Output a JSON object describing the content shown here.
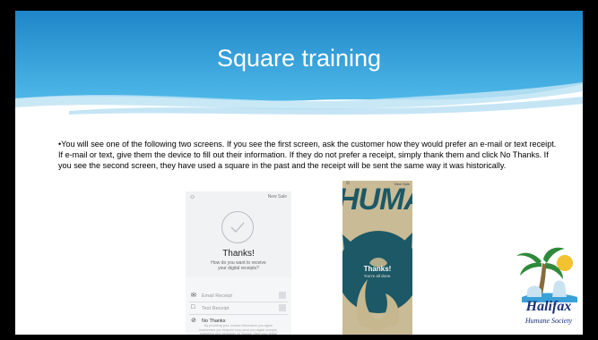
{
  "slide": {
    "title": "Square training",
    "body": "•You will see one of the following two screens. If you see the first screen, ask the customer how they would prefer an e-mail or text receipt. If e-mail or text, give them the device to fill out their information. If they do not prefer a receipt, simply thank them and click No Thanks. If you see the second screen, they have used a square in the past and the receipt will be sent the same way it was historically."
  },
  "screen1": {
    "profile_icon": "person-icon",
    "new_sale": "New Sale",
    "thanks": "Thanks!",
    "question": "How do you want to receive your digital receipts?",
    "email_placeholder": "Email Receipt",
    "text_placeholder": "Text Receipt",
    "no_thanks": "No Thanks",
    "fine_print": "By providing your contact information you agree businesses you frequent may send you digital receipts, marketing and messages on Square. View your digital receipt for privacy policy and preferences."
  },
  "screen2": {
    "new_sale": "New Sale",
    "brand_text": "HUMANE",
    "thanks": "Thanks!",
    "subtext": "You're all done."
  },
  "logo": {
    "name": "Halifax",
    "subtitle": "Humane Society",
    "colors": {
      "primary": "#18307a",
      "palm": "#2e8a3a",
      "sun": "#f2c230"
    }
  },
  "colors": {
    "banner": "#3aa8de",
    "banner_dark": "#1f7fc0"
  }
}
